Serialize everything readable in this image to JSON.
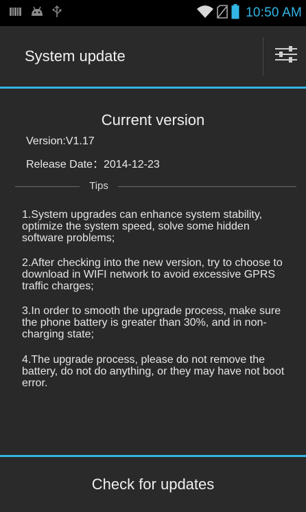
{
  "status_bar": {
    "time": "10:50 AM",
    "icons": [
      "barcode-icon",
      "android-debug-icon",
      "usb-icon",
      "wifi-icon",
      "no-sim-icon",
      "battery-icon"
    ],
    "accent_color": "#33b5e5"
  },
  "action_bar": {
    "title": "System update",
    "settings_icon": "sliders-icon"
  },
  "current_version": {
    "heading": "Current version",
    "version": "Version:V1.17",
    "release_date": "Release Date：2014-12-23"
  },
  "tips": {
    "label": "Tips",
    "items": [
      "1.System upgrades can enhance system stability, optimize the system speed, solve some hidden software problems;",
      "2.After checking into the new version, try to choose to download in WIFI network to avoid excessive GPRS traffic charges;",
      "3.In order to smooth the upgrade process, make sure the phone battery is greater than 30%, and in non-charging state;",
      "4.The upgrade process, please do not remove the battery, do not do anything, or they may have not boot error."
    ]
  },
  "footer": {
    "check_button": "Check for updates"
  }
}
